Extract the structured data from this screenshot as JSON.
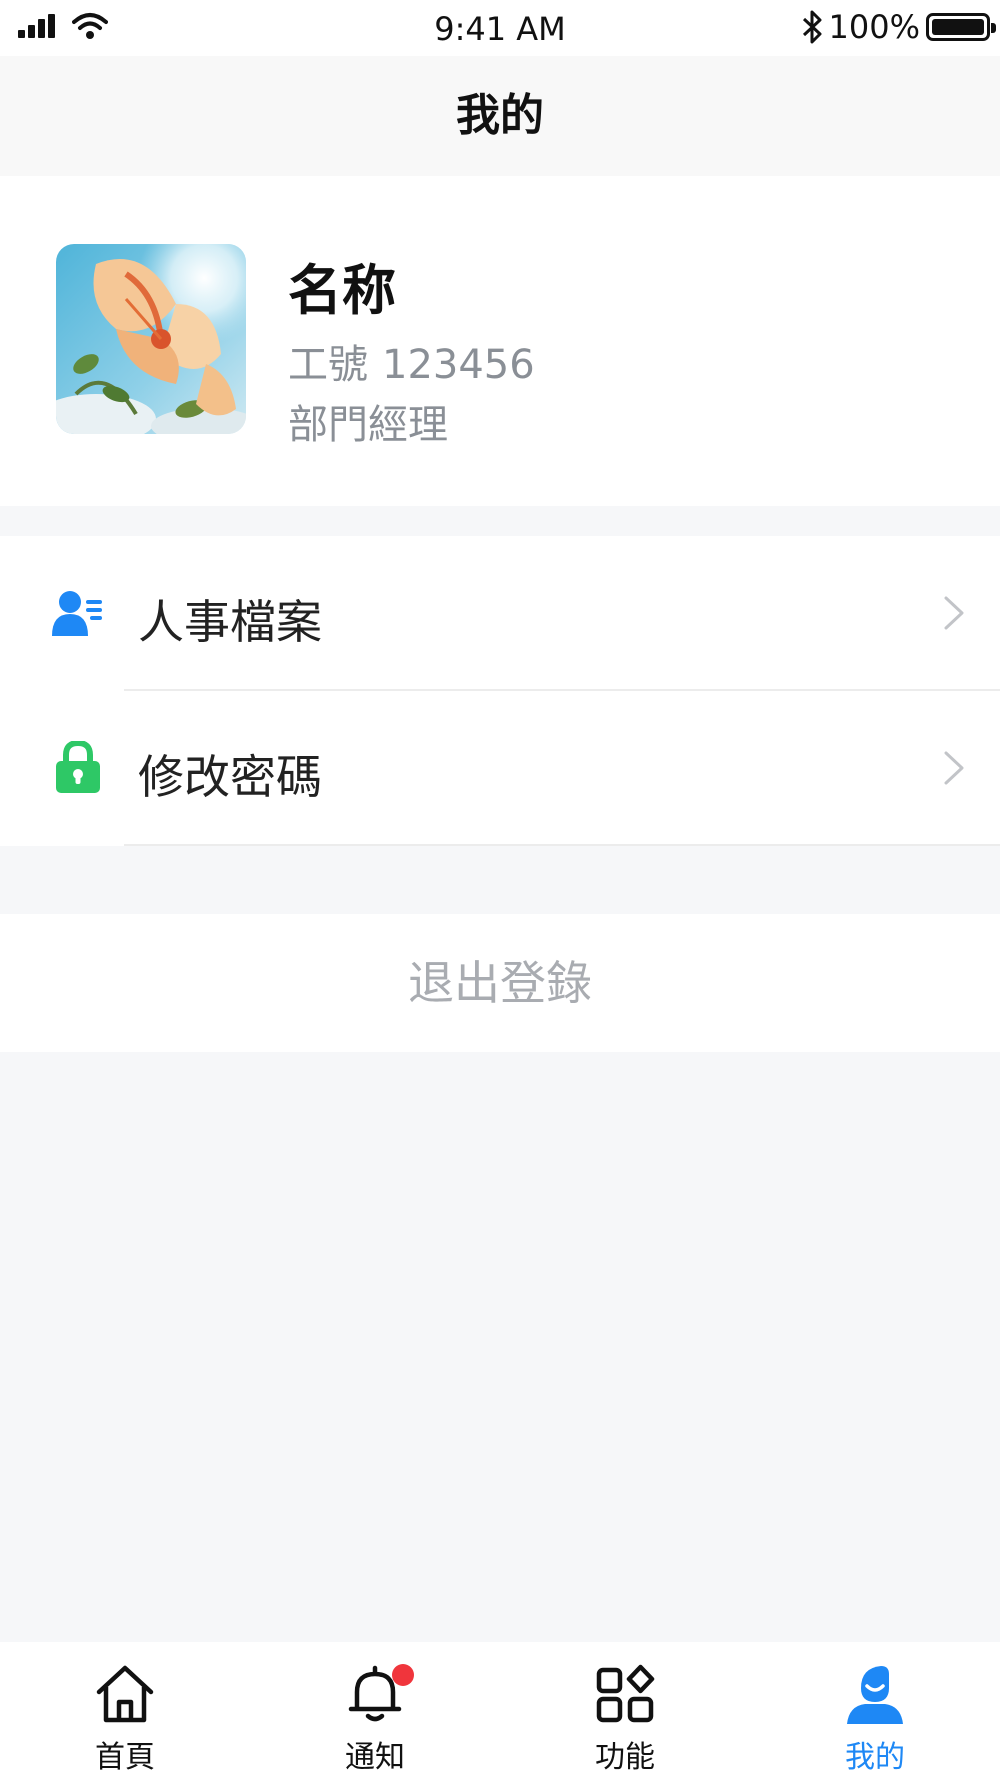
{
  "status_bar": {
    "time": "9:41 AM",
    "battery_percent": "100%",
    "battery_level": 1.0,
    "icons": [
      "signal-icon",
      "wifi-icon",
      "bluetooth-icon",
      "battery-icon"
    ]
  },
  "header": {
    "title": "我的"
  },
  "profile": {
    "name": "名称",
    "employee_id_label": "工號",
    "employee_id": "123456",
    "department": "部門經理",
    "avatar": "flower-photo"
  },
  "menu": {
    "items": [
      {
        "label": "人事檔案",
        "icon": "personnel-file-icon",
        "icon_color": "#1e88f5"
      },
      {
        "label": "修改密碼",
        "icon": "lock-icon",
        "icon_color": "#2ec866"
      }
    ]
  },
  "logout": {
    "label": "退出登錄"
  },
  "tabbar": {
    "active_color": "#1e88f5",
    "tabs": [
      {
        "label": "首頁",
        "icon": "home-icon",
        "active": false
      },
      {
        "label": "通知",
        "icon": "bell-icon",
        "active": false,
        "badge": true
      },
      {
        "label": "功能",
        "icon": "apps-icon",
        "active": false
      },
      {
        "label": "我的",
        "icon": "user-icon",
        "active": true
      }
    ]
  }
}
